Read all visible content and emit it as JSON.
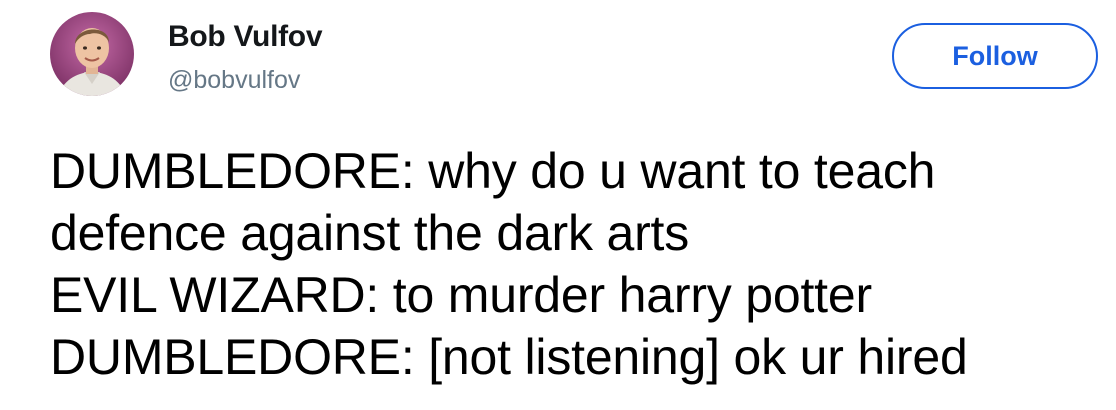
{
  "author": {
    "display_name": "Bob Vulfov",
    "handle": "@bobvulfov",
    "avatar_icon": "user-portrait-avatar"
  },
  "follow_button": {
    "label": "Follow"
  },
  "tweet": {
    "lines": [
      "DUMBLEDORE: why do u want to teach",
      "defence against the dark arts",
      "EVIL WIZARD: to murder harry potter",
      "DUMBLEDORE: [not listening] ok ur hired"
    ]
  },
  "colors": {
    "accent": "#1b5fe0",
    "handle_gray": "#657786",
    "text": "#000000"
  }
}
